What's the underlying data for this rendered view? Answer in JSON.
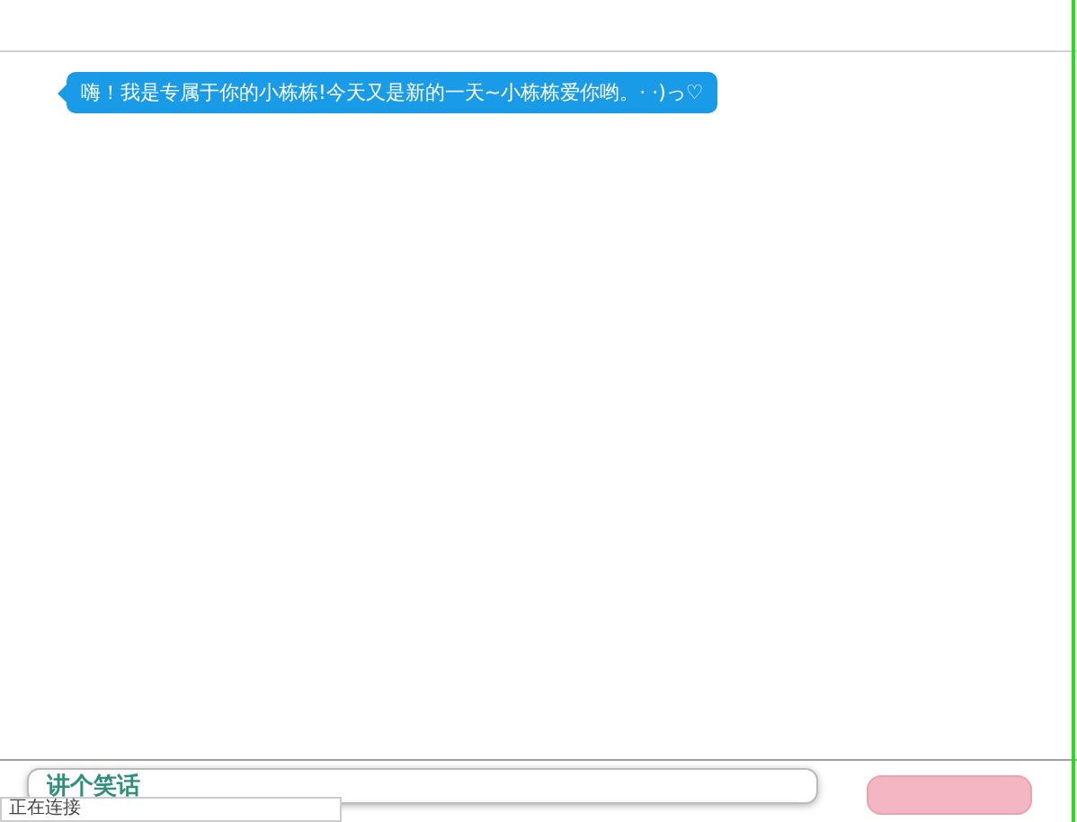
{
  "messages": [
    {
      "kind": "bot",
      "text": "嗨！我是专属于你的小栋栋!今天又是新的一天~小栋栋爱你哟。· ·)っ♡"
    }
  ],
  "composer": {
    "value": "讲个笑话"
  },
  "status": {
    "text": "正在连接"
  }
}
